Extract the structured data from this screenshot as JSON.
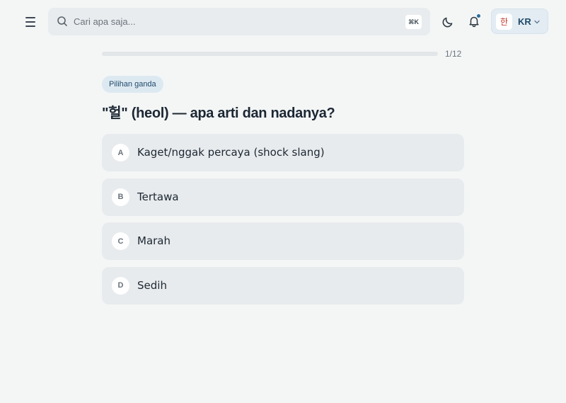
{
  "header": {
    "search_placeholder": "Cari apa saja...",
    "search_shortcut": "⌘K",
    "language": {
      "flag_glyph": "한",
      "code": "KR"
    },
    "notification_badge": true
  },
  "progress": {
    "current": 1,
    "total": 12,
    "label": "1/12",
    "fraction": 0.0833
  },
  "question": {
    "type_label": "Pilihan ganda",
    "prompt": "\"헐\" (heol) — apa arti dan nadanya?",
    "options": [
      {
        "letter": "A",
        "text": "Kaget/nggak percaya (shock slang)"
      },
      {
        "letter": "B",
        "text": "Tertawa"
      },
      {
        "letter": "C",
        "text": "Marah"
      },
      {
        "letter": "D",
        "text": "Sedih"
      }
    ]
  },
  "colors": {
    "background": "#f4f6f6",
    "accent": "#2b6f9c",
    "option_bg": "#e8ebed",
    "badge_bg": "#dde9f1"
  }
}
